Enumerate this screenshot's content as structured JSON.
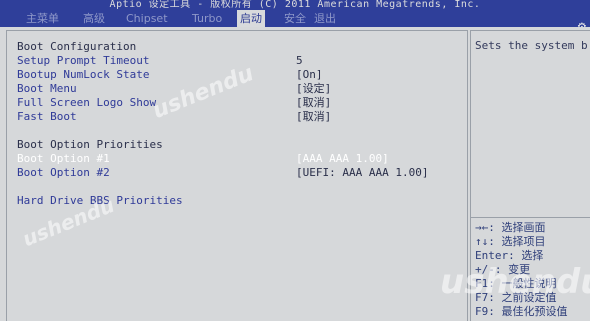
{
  "header": {
    "title": "Aptio 设定工具 - 版权所有 (C) 2011 American Megatrends, Inc."
  },
  "tabs": [
    {
      "label": "主菜单"
    },
    {
      "label": "高级"
    },
    {
      "label": "Chipset"
    },
    {
      "label": "Turbo"
    },
    {
      "label": "启动",
      "active": true
    },
    {
      "label": "安全"
    },
    {
      "label": "退出"
    }
  ],
  "settings": {
    "boot_configuration": "Boot Configuration",
    "setup_prompt_timeout": {
      "label": "Setup Prompt Timeout",
      "value": "5"
    },
    "bootup_numlock_state": {
      "label": "Bootup NumLock State",
      "value": "[On]"
    },
    "boot_menu": {
      "label": "Boot Menu",
      "value": "[设定]"
    },
    "full_screen_logo_show": {
      "label": "Full Screen Logo Show",
      "value": "[取消]"
    },
    "fast_boot": {
      "label": "Fast Boot",
      "value": "[取消]"
    },
    "boot_option_priorities": "Boot Option Priorities",
    "boot_option_1": {
      "label": "Boot Option #1",
      "value": "[AAA AAA 1.00]"
    },
    "boot_option_2": {
      "label": "Boot Option #2",
      "value": "[UEFI: AAA AAA 1.00]"
    },
    "hard_drive_bbs": {
      "label": "Hard Drive BBS Priorities"
    }
  },
  "help": {
    "description": "Sets the system b",
    "keys": [
      "→←: 选择画面",
      "↑↓: 选择项目",
      "Enter: 选择",
      "+/-: 变更",
      "F1: 一般性说明",
      "F7: 之前设定值",
      "F9: 最佳化预设值"
    ]
  },
  "watermarks": [
    "ushendu",
    "ushendu",
    "ushendu"
  ],
  "icons": {
    "corner": "gear-icon"
  },
  "colors": {
    "topbar": "#2f3f9a",
    "panel": "#d6d8da",
    "label": "#2f3a98",
    "selected": "#ffffff"
  }
}
